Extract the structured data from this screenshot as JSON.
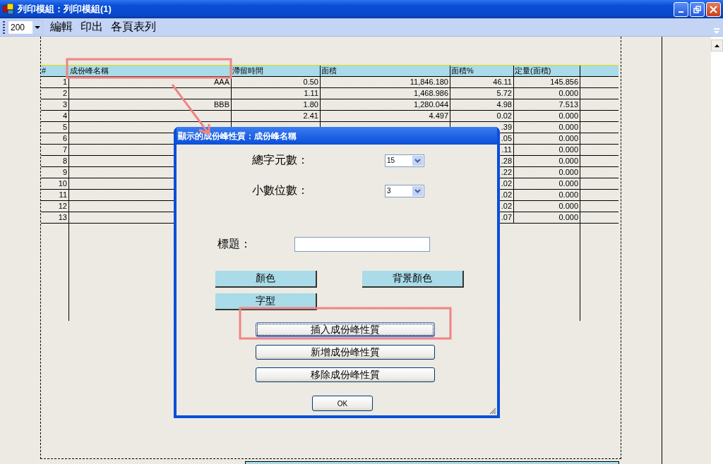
{
  "window": {
    "title": "列印模組：列印模組(1)"
  },
  "toolbar": {
    "zoom": "200",
    "menu": [
      "編輯",
      "印出",
      "各頁表列"
    ]
  },
  "table": {
    "columns": [
      "#",
      "成份峰名稱",
      "滯留時間",
      "面積",
      "面積%",
      "定量(面積)"
    ],
    "rows": [
      [
        "1",
        "AAA",
        "0.50",
        "11,846.180",
        "46.11",
        "145.856"
      ],
      [
        "2",
        "",
        "1.11",
        "1,468.986",
        "5.72",
        "0.000"
      ],
      [
        "3",
        "BBB",
        "1.80",
        "1,280.044",
        "4.98",
        "7.513"
      ],
      [
        "4",
        "",
        "2.41",
        "4.497",
        "0.02",
        "0.000"
      ],
      [
        "5",
        "",
        "",
        "",
        ".39",
        "0.000"
      ],
      [
        "6",
        "",
        "",
        "",
        ".05",
        "0.000"
      ],
      [
        "7",
        "",
        "",
        "",
        ".11",
        "0.000"
      ],
      [
        "8",
        "",
        "",
        "",
        ".28",
        "0.000"
      ],
      [
        "9",
        "",
        "",
        "",
        ".22",
        "0.000"
      ],
      [
        "10",
        "",
        "",
        "",
        ".02",
        "0.000"
      ],
      [
        "11",
        "",
        "",
        "",
        ".02",
        "0.000"
      ],
      [
        "12",
        "",
        "",
        "",
        ".02",
        "0.000"
      ],
      [
        "13",
        "",
        "",
        "",
        ".07",
        "0.000"
      ]
    ]
  },
  "dialog": {
    "title": "顯示的成份峰性質：成份峰名稱",
    "fields": [
      {
        "kind": "dropdown",
        "label": "總字元數：",
        "value": "15"
      },
      {
        "kind": "dropdown",
        "label": "小數位數：",
        "value": "3"
      },
      {
        "kind": "text",
        "label": "標題："
      }
    ],
    "style_buttons": [
      "顏色",
      "背景顏色",
      "字型"
    ],
    "action_buttons": [
      {
        "label": "插入成份峰性質",
        "focused": true
      },
      {
        "label": "新增成份峰性質",
        "focused": false
      },
      {
        "label": "移除成份峰性質",
        "focused": false
      }
    ],
    "ok": "OK"
  }
}
